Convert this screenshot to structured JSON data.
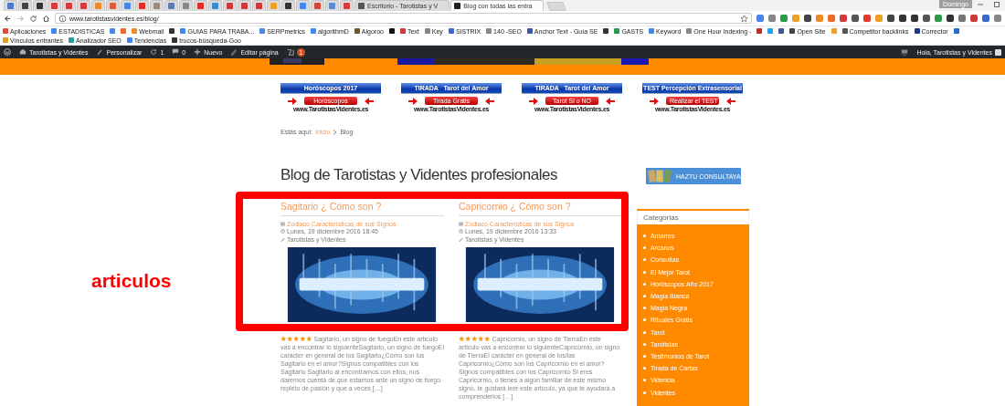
{
  "browser": {
    "tabs": [
      {
        "color": "#4a7bd0",
        "selected": false
      },
      {
        "color": "#444444",
        "selected": false
      },
      {
        "color": "#333333",
        "selected": false
      },
      {
        "color": "#d93a3a",
        "selected": false
      },
      {
        "color": "#d93a3a",
        "selected": false
      },
      {
        "color": "#d93a3a",
        "selected": false
      },
      {
        "color": "#f08a24",
        "selected": false
      },
      {
        "color": "#e05a3a",
        "selected": false
      },
      {
        "color": "#4a86e8",
        "selected": false
      },
      {
        "color": "#e52d27",
        "selected": false
      },
      {
        "color": "#9a8a7a",
        "selected": false
      },
      {
        "color": "#5a7ab0",
        "selected": false
      },
      {
        "color": "#888888",
        "selected": false
      },
      {
        "color": "#e52d27",
        "selected": false
      },
      {
        "color": "#3a8ad0",
        "selected": false
      },
      {
        "color": "#d03a3a",
        "selected": false
      },
      {
        "color": "#d03a3a",
        "selected": false
      },
      {
        "color": "#d03a3a",
        "selected": false
      },
      {
        "color": "#f0a020",
        "selected": false
      },
      {
        "color": "#333333",
        "selected": false
      },
      {
        "color": "#4285f4",
        "selected": false
      },
      {
        "color": "#d44638",
        "selected": false
      },
      {
        "color": "#5a8ad0",
        "selected": false
      },
      {
        "color": "#d93a3a",
        "selected": false
      },
      {
        "title": "Escritorio - Tarotistas y V",
        "selected": false
      },
      {
        "title": "Blog con todas las entra",
        "selected": true
      }
    ],
    "profile": "Domingo",
    "address": "www.tarotistasvidentes.es/blog/",
    "bookmarks": [
      {
        "kind": "link",
        "label": "Aplicaciones"
      },
      {
        "kind": "link",
        "label": "ESTADISTICAS"
      },
      {
        "kind": "icon"
      },
      {
        "kind": "icon"
      },
      {
        "kind": "link",
        "label": "Webmail"
      },
      {
        "kind": "icon"
      },
      {
        "kind": "link",
        "label": "GUIAS PARA TRABA..."
      },
      {
        "kind": "link",
        "label": "SERPmetrics"
      },
      {
        "kind": "link",
        "label": "algorithmD"
      },
      {
        "kind": "link",
        "label": "Algoroo"
      },
      {
        "kind": "icon"
      },
      {
        "kind": "link",
        "label": "Text"
      },
      {
        "kind": "link",
        "label": "Key"
      },
      {
        "kind": "link",
        "label": "SISTRIX"
      },
      {
        "kind": "link",
        "label": "140 -SEO"
      },
      {
        "kind": "link",
        "label": "Anchor Text - Guía SE"
      },
      {
        "kind": "icon"
      },
      {
        "kind": "link",
        "label": "GASTS"
      },
      {
        "kind": "link",
        "label": "Keyword"
      },
      {
        "kind": "link",
        "label": "One Hour Indexing -"
      },
      {
        "kind": "icon"
      },
      {
        "kind": "icon"
      },
      {
        "kind": "icon"
      },
      {
        "kind": "link",
        "label": "Open Site"
      },
      {
        "kind": "icon"
      },
      {
        "kind": "link",
        "label": "Competitor backlinks"
      },
      {
        "kind": "link",
        "label": "Corrector"
      },
      {
        "kind": "icon"
      },
      {
        "kind": "link",
        "label": "Vínculos entrantes"
      },
      {
        "kind": "link",
        "label": "Analizador SEO"
      },
      {
        "kind": "link",
        "label": "Tendencias"
      },
      {
        "kind": "link",
        "label": "trucos-búsqueda-Goo"
      }
    ]
  },
  "admin_bar": {
    "site": "Tarotistas y Videntes",
    "customize": "Personalizar",
    "updates": "1",
    "comments": "0",
    "new": "Nuevo",
    "edit": "Editar página",
    "seo_badge": "1",
    "greeting": "Hola, Tarotistas y Videntes"
  },
  "banners": [
    {
      "title": "Horóscopos 2017",
      "button": "Horóscopos",
      "site": "www.TarotistasVidentes.es"
    },
    {
      "title": "TIRADA   Tarot del Amor",
      "button": "Tirada Gratis",
      "site": "www.TarotistasVidentes.es"
    },
    {
      "title": "TIRADA   Tarot del Amor",
      "button": "Tarot Si o NO",
      "site": "www.TarotistasVidentes.es"
    },
    {
      "title": "TEST Percepción Extrasensorial",
      "button": "Realizar el TEST",
      "site": "www.TarotistasVidentes.es"
    }
  ],
  "breadcrumb": {
    "prefix": "Estás aquí:",
    "items": [
      "Inicio",
      "Blog"
    ]
  },
  "page_title": "Blog de Tarotistas y Videntes profesionales",
  "posts": [
    {
      "title": "Sagitario ¿ Cómo son ?",
      "category": "Zodiaco Características de sus Signos",
      "date": "Lunes, 19 diciembre 2016 18:45",
      "author": "Tarotistas y Videntes",
      "stars": 5,
      "excerpt": "Sagitario, un signo de fuegoEn este articulo vas a encontrar lo siguienteSagitario, un signo de fuegoEl carácter en general de los Sagitario¿Cómo son los Sagitario en el amor?Signos compatibles con los Sagitario Sagitario al encontrarnos con ellos, nos daremos cuenta de que estamos ante un signo de fuego repleto de pasión y que a veces […]"
    },
    {
      "title": "Capricornio ¿ Cómo son ?",
      "category": "Zodiaco Características de sus Signos",
      "date": "Lunes, 19 diciembre 2016 13:33",
      "author": "Tarotistas y Videntes",
      "stars": 5,
      "excerpt": "Capricornio, un signo de TierraEn este articulo vas a encontrar lo siguienteCapricornio, un signo de TierraEl carácter en general de los/las Capricornio¿Cómo son los Capricornio en el amor?Signos compatibles con los Capricornio Si eres Capricornio, o tienes a algún familiar de este mismo signo, te gustará leer este artículo, ya que te ayudará a comprenderlos […]"
    }
  ],
  "sidebar": {
    "ad": "HAZTU CONSULTAYA",
    "widget_title": "Categorias",
    "categories": [
      "Amarres",
      "Arcanos",
      "Consultas",
      "El Mejor Tarot",
      "Horóscopos Año 2017",
      "Magia Blanca",
      "Magia Negra",
      "Rituales Gratis",
      "Tarot",
      "Tarotistas",
      "Testimonios de Tarot",
      "Tirada de Cartas",
      "Videncia",
      "Videntes"
    ]
  },
  "annotation": {
    "label": "articulos"
  }
}
